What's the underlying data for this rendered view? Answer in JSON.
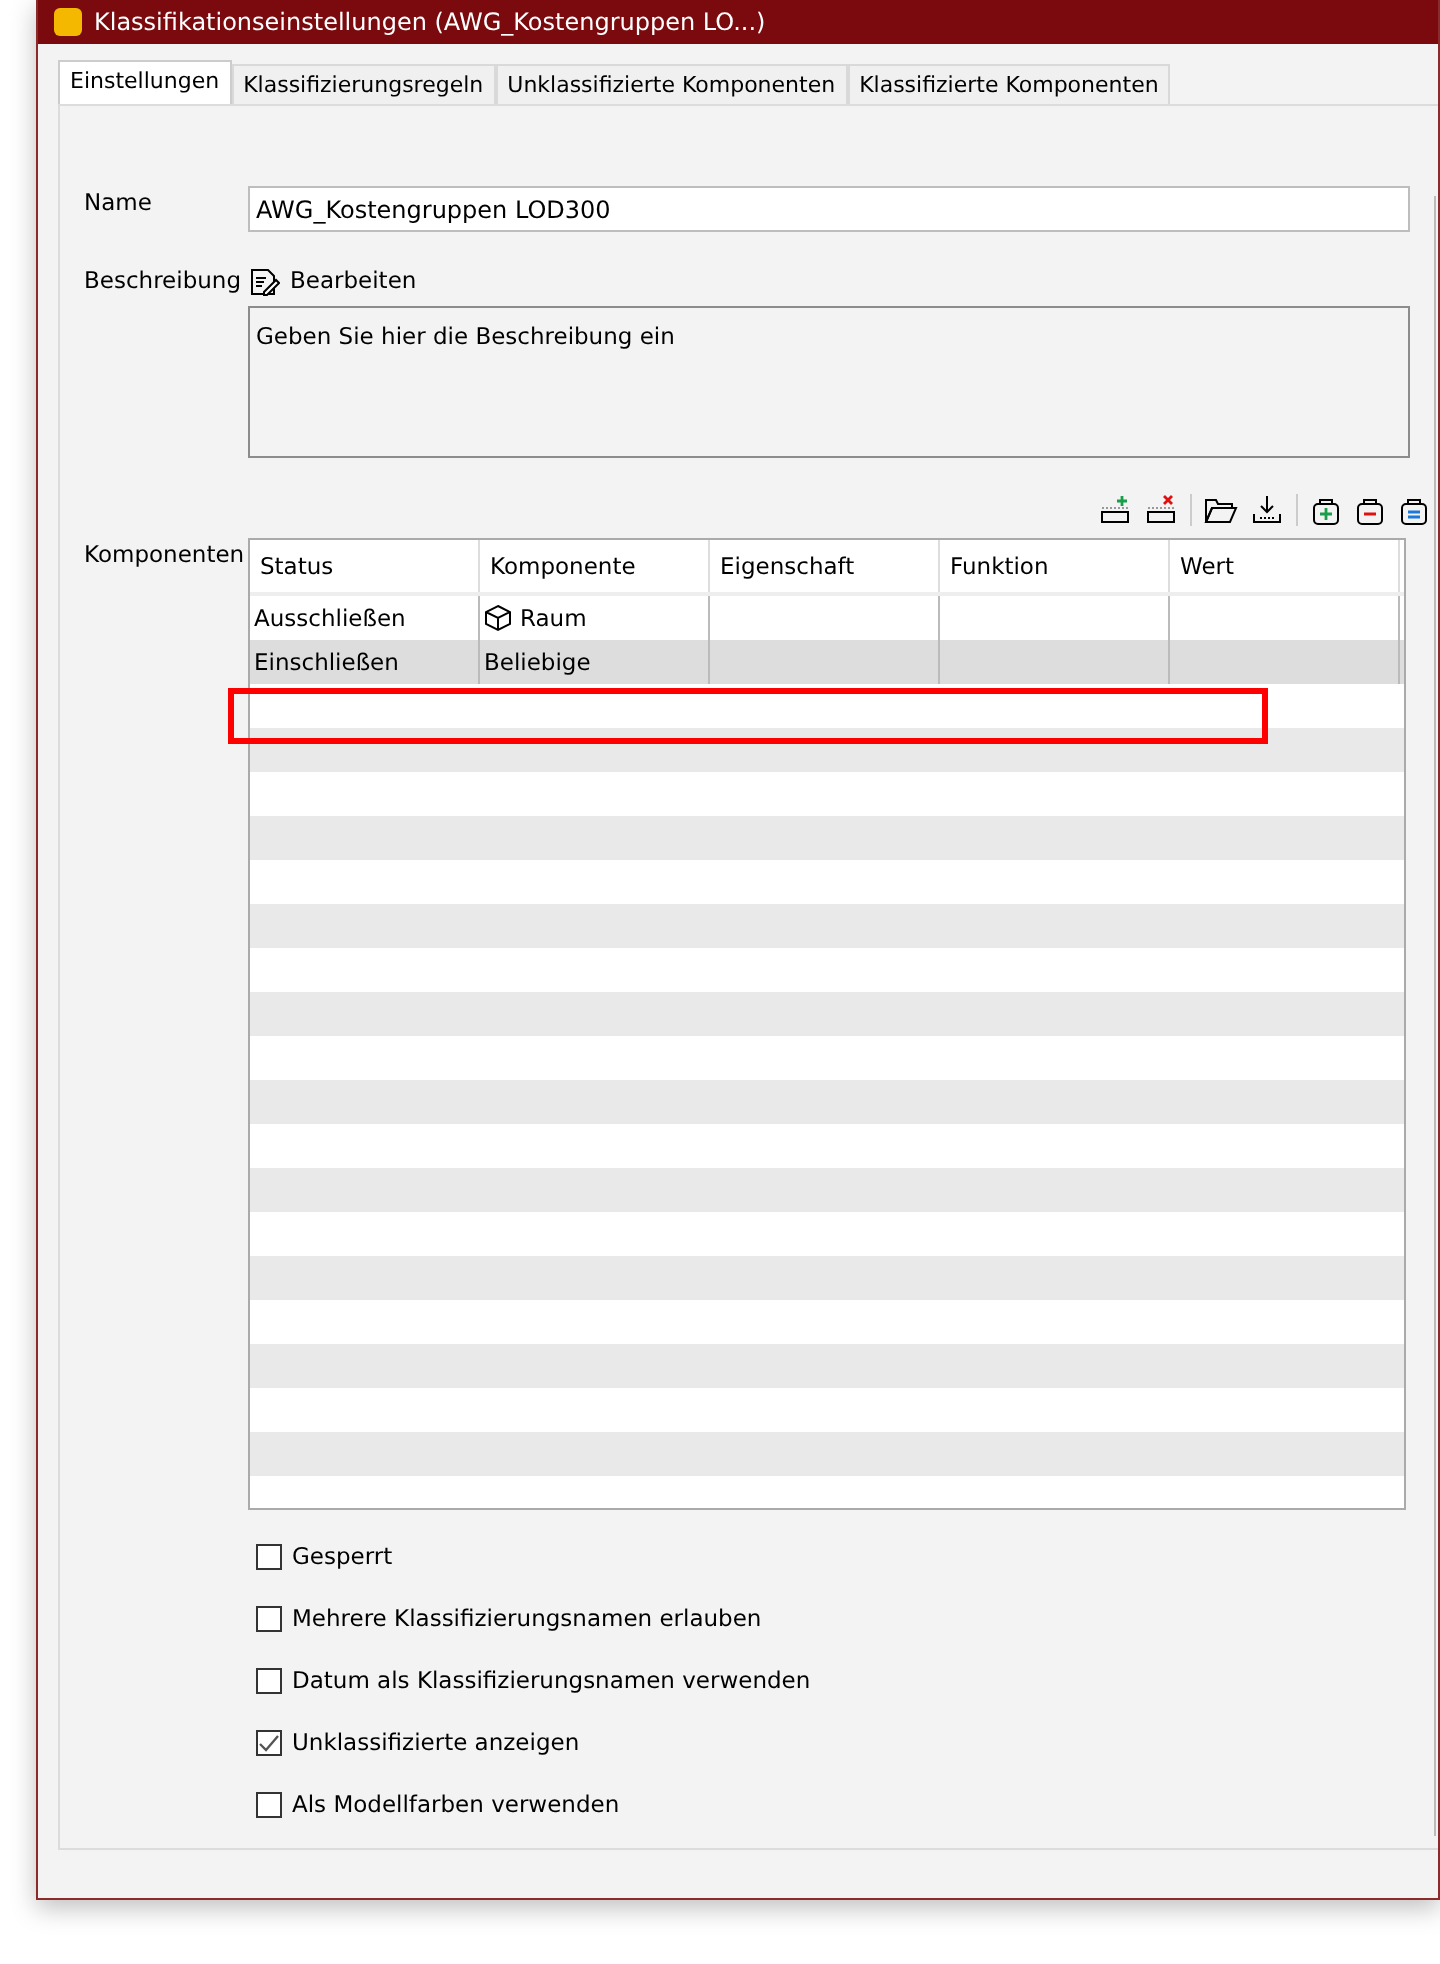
{
  "window": {
    "title": "Klassifikationseinstellungen (AWG_Kostengruppen LO...)"
  },
  "tabs": [
    {
      "label": "Einstellungen",
      "selected": true
    },
    {
      "label": "Klassifizierungsregeln",
      "selected": false
    },
    {
      "label": "Unklassifizierte Komponenten",
      "selected": false
    },
    {
      "label": "Klassifizierte Komponenten",
      "selected": false
    }
  ],
  "name": {
    "label": "Name",
    "value": "AWG_Kostengruppen LOD300"
  },
  "description": {
    "label": "Beschreibung",
    "edit_button": "Bearbeiten",
    "value": "Geben Sie hier die Beschreibung ein"
  },
  "components": {
    "label": "Komponenten",
    "columns": [
      "Status",
      "Komponente",
      "Eigenschaft",
      "Funktion",
      "Wert"
    ],
    "rows": [
      {
        "status": "Ausschließen",
        "component": "Raum",
        "has_icon": true,
        "selected": false
      },
      {
        "status": "Einschließen",
        "component": "Beliebige",
        "has_icon": false,
        "selected": true
      }
    ],
    "highlight_frame": true
  },
  "options": [
    {
      "label": "Gesperrt",
      "checked": false
    },
    {
      "label": "Mehrere Klassifizierungsnamen erlauben",
      "checked": false
    },
    {
      "label": "Datum als Klassifizierungsnamen verwenden",
      "checked": false
    },
    {
      "label": "Unklassifizierte anzeigen",
      "checked": true
    },
    {
      "label": "Als Modellfarben verwenden",
      "checked": false
    }
  ]
}
